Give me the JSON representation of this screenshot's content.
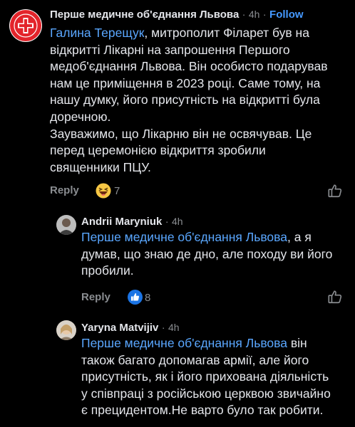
{
  "comment1": {
    "author": "Перше медичне об'єднання Львова",
    "sep": "·",
    "time": "4h",
    "follow": "Follow",
    "mention": "Галина Терещук",
    "text_after_mention": ", митрополит Філарет був на",
    "lines": [
      "відкритті Лікарні на запрошення Першого",
      "медоб'єднання Львова. Він особисто подарував",
      "нам це приміщення в 2023 році. Саме тому, на",
      "нашу думку, його присутність на відкритті була",
      "доречною.",
      "Зауважимо, що Лікарню він не освячував. Це",
      "перед церемонією відкриття зробили",
      "священники ПЦУ."
    ],
    "reply": "Reply",
    "reaction_icon": "haha-emoji-icon",
    "reaction_count": "7"
  },
  "comment2": {
    "author": "Andrii Maryniuk",
    "sep": "·",
    "time": "4h",
    "mention": "Перше медичне об'єднання Львова",
    "text_after_mention": ", а я",
    "lines": [
      "думав, що знаю де дно, але походу ви його",
      "пробили."
    ],
    "reply": "Reply",
    "reaction_icon": "like-reaction-icon",
    "reaction_count": "8"
  },
  "comment3": {
    "author": "Yaryna Matvijiv",
    "sep": "·",
    "time": "4h",
    "mention": "Перше медичне об'єднання Львова",
    "text_after_mention": " він",
    "lines": [
      "також багато допомагав армії, але його",
      "присутність, як і його прихована діяльність",
      "у співпраці з російською церквою звичайно",
      "є прецидентом.Не варто було так робити."
    ]
  },
  "colors": {
    "background": "#000000",
    "text": "#e4e6eb",
    "secondary": "#8a8d91",
    "link": "#5aa7ff",
    "follow": "#4599ff",
    "logo_red": "#e3242b"
  }
}
